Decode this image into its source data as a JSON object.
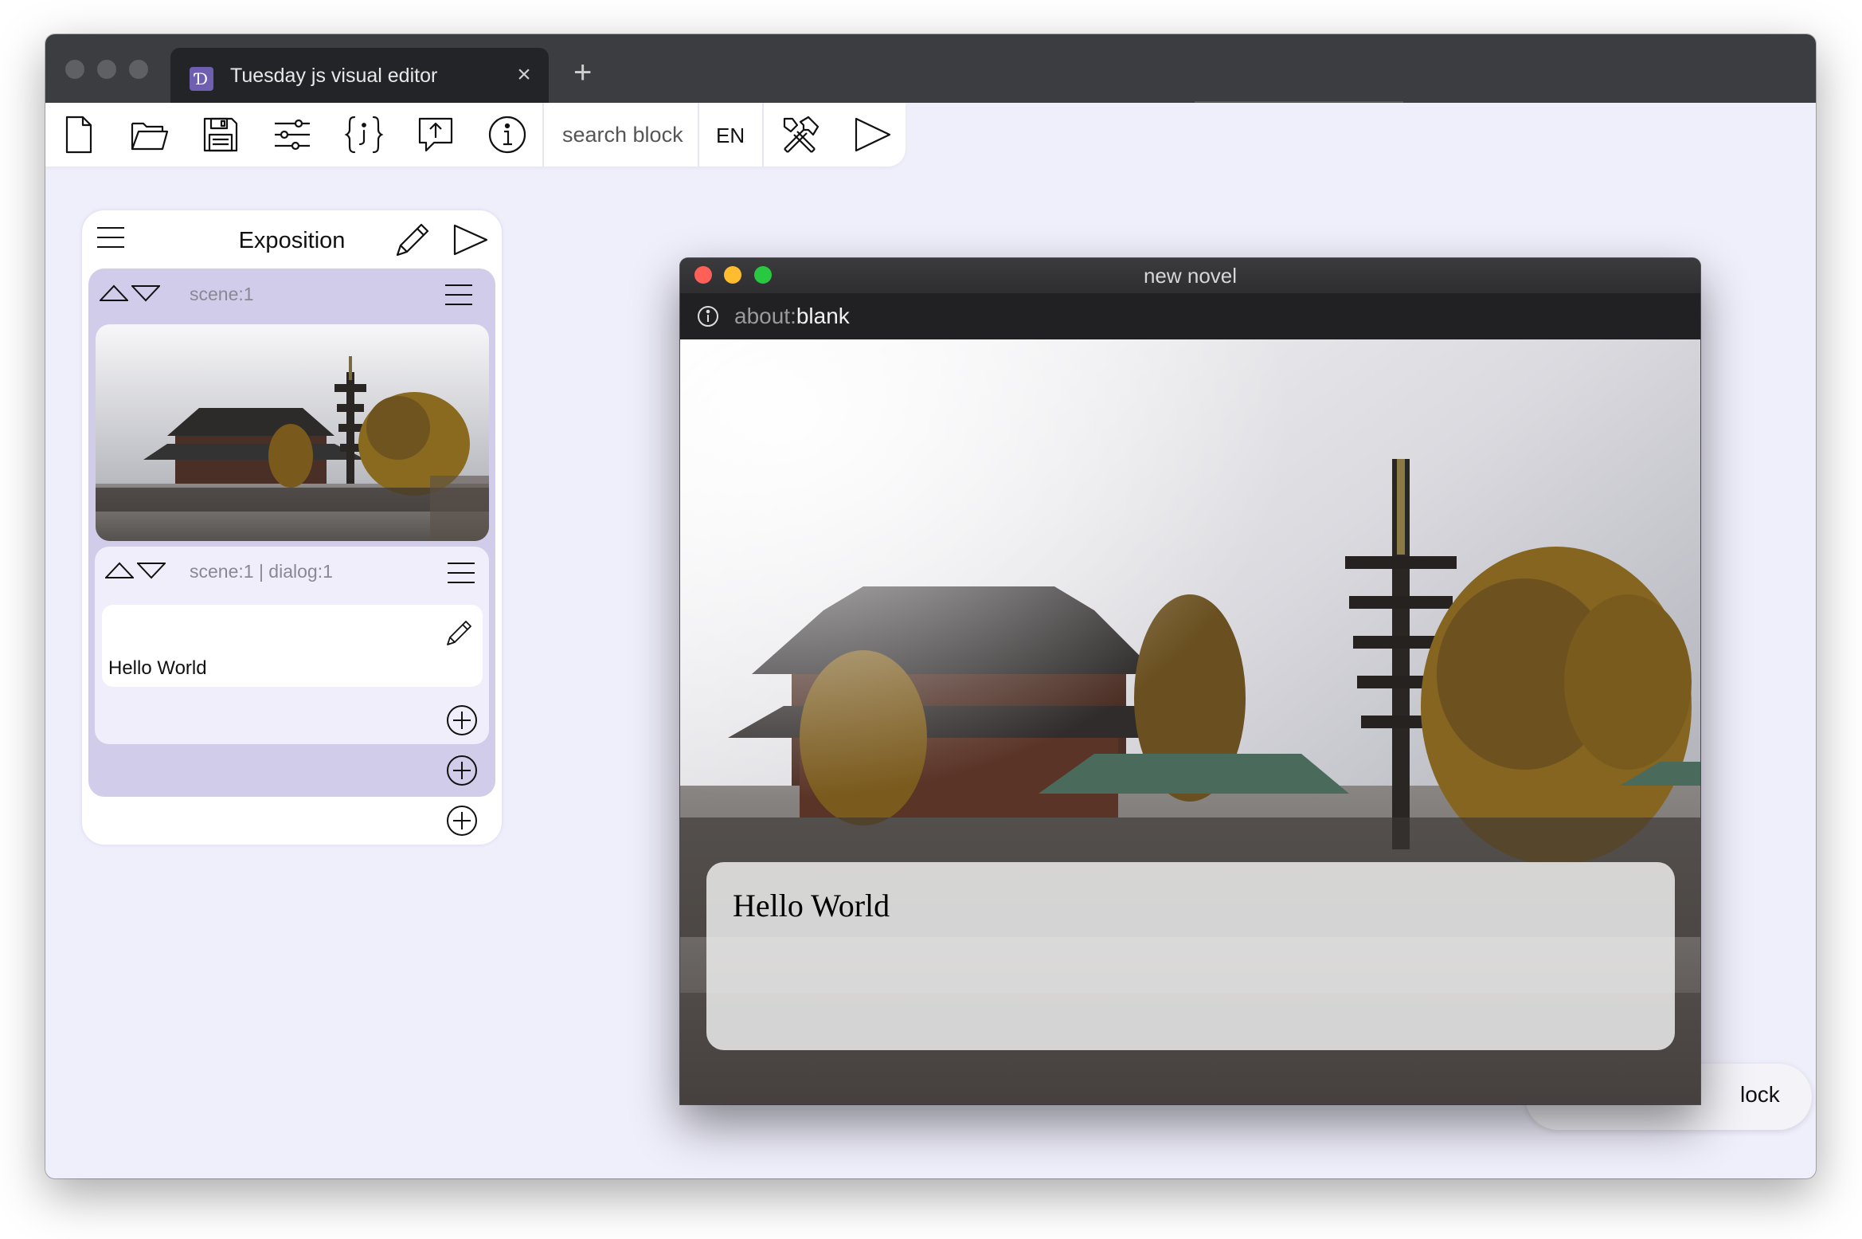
{
  "browser": {
    "tab_title": "Tuesday js visual editor",
    "tab_favicon": "Ɗ",
    "tab_close": "×",
    "new_tab": "+"
  },
  "toolbar": {
    "icons": [
      "new-file-icon",
      "open-folder-icon",
      "save-icon",
      "settings-sliders-icon",
      "code-braces-icon",
      "export-icon",
      "info-icon",
      "tools-icon",
      "play-icon"
    ],
    "search_label": "search block",
    "language": "EN"
  },
  "panel": {
    "title": "Exposition",
    "scene_block": {
      "label": "scene:1",
      "dialog": {
        "label": "scene:1 | dialog:1",
        "text": "Hello World"
      }
    }
  },
  "preview": {
    "window_title": "new novel",
    "url_scheme": "about:",
    "url_path": "blank",
    "dialog_text": "Hello World"
  },
  "hint": {
    "text": "lock"
  }
}
